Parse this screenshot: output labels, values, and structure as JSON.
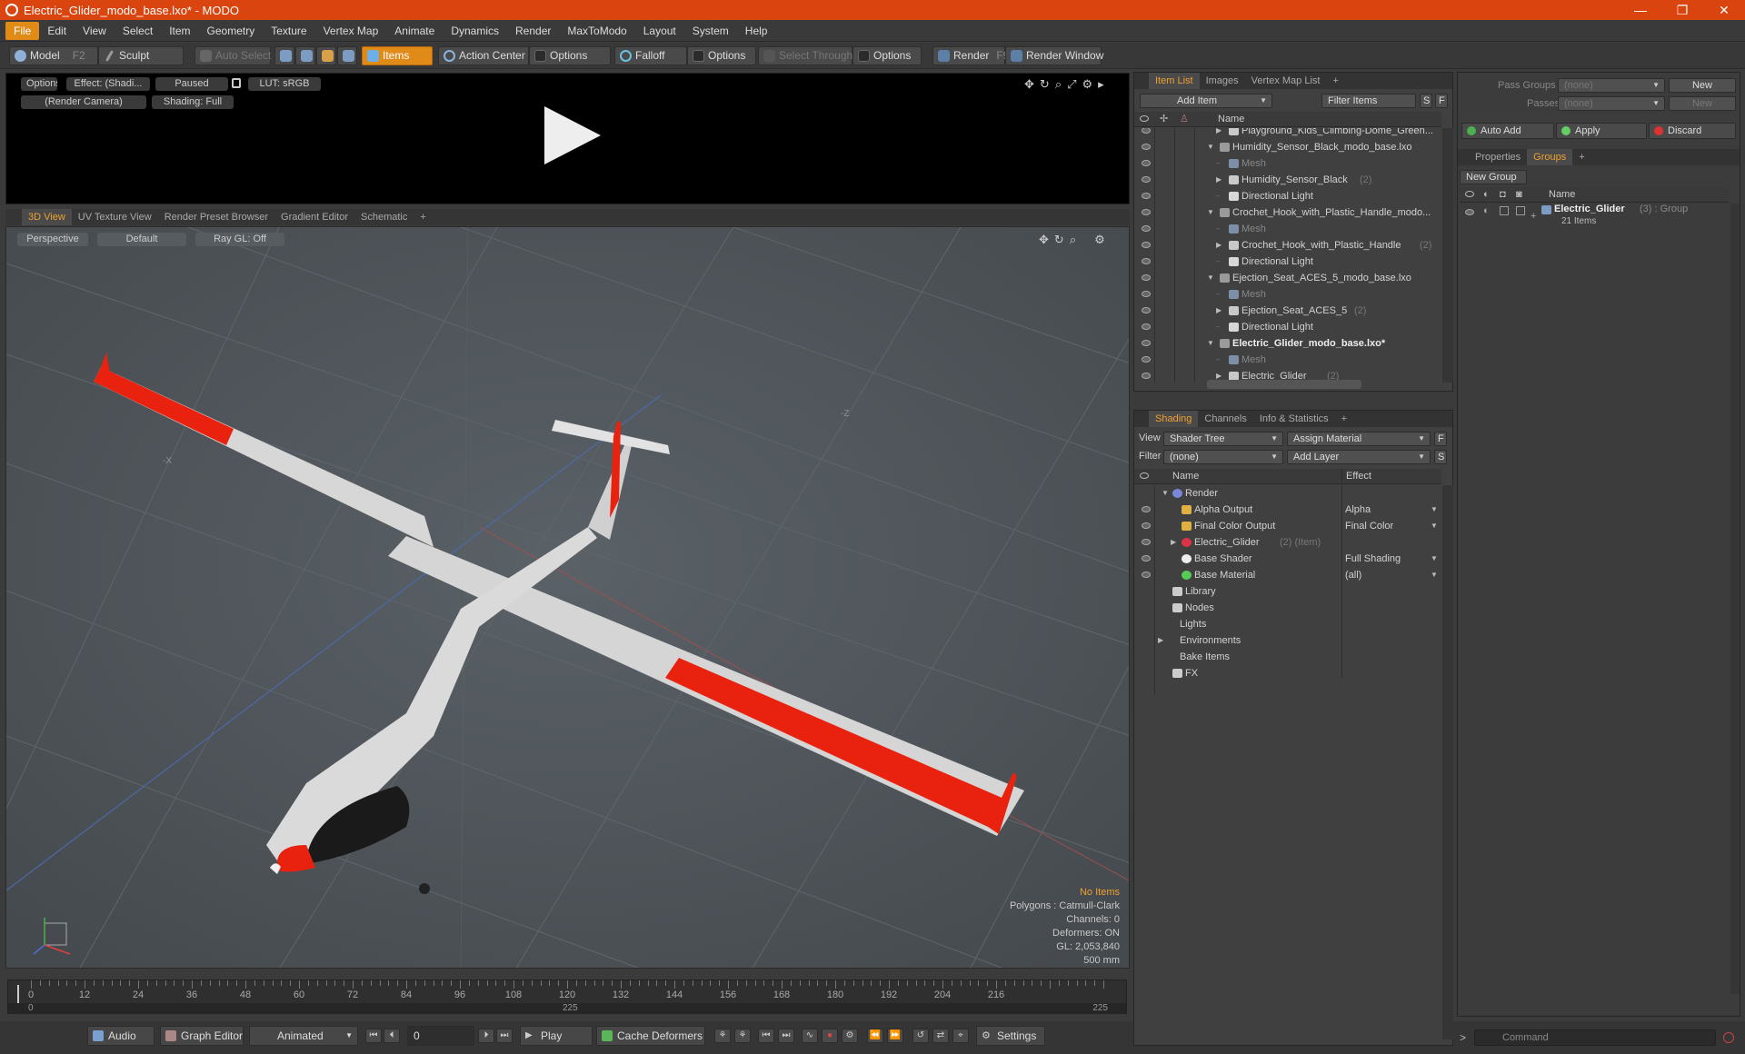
{
  "window": {
    "title": "Electric_Glider_modo_base.lxo* - MODO",
    "controls": [
      "—",
      "❐",
      "✕"
    ]
  },
  "menu": [
    "File",
    "Edit",
    "View",
    "Select",
    "Item",
    "Geometry",
    "Texture",
    "Vertex Map",
    "Animate",
    "Dynamics",
    "Render",
    "MaxToModo",
    "Layout",
    "System",
    "Help"
  ],
  "toolbar": {
    "model": "Model",
    "model_key": "F2",
    "sculpt": "Sculpt",
    "auto_select": "Auto Select",
    "items": "Items",
    "action_center": "Action Center",
    "options1": "Options",
    "falloff": "Falloff",
    "options2": "Options",
    "select_through": "Select Through",
    "options3": "Options",
    "render": "Render",
    "render_key": "F9",
    "render_window": "Render Window"
  },
  "render_panel": {
    "options": "Options",
    "effect": "Effect: (Shadi...",
    "paused": "Paused",
    "lut": "LUT: sRGB",
    "camera": "(Render Camera)",
    "shading": "Shading: Full"
  },
  "viewport_tabs": [
    "3D View",
    "UV Texture View",
    "Render Preset Browser",
    "Gradient Editor",
    "Schematic",
    "+"
  ],
  "viewport": {
    "perspective": "Perspective",
    "default": "Default",
    "raygl": "Ray GL: Off",
    "axis_x": "-X",
    "axis_z": "-Z",
    "stats": [
      "No Items",
      "Polygons : Catmull-Clark",
      "Channels: 0",
      "Deformers: ON",
      "GL: 2,053,840",
      "500 mm"
    ]
  },
  "timeline": {
    "labels": [
      "0",
      "12",
      "24",
      "36",
      "48",
      "60",
      "72",
      "84",
      "96",
      "108",
      "120",
      "132",
      "144",
      "156",
      "168",
      "180",
      "192",
      "204",
      "216"
    ],
    "bottom_left": "0",
    "bottom_mid": "225",
    "bottom_right": "225"
  },
  "bottombar": {
    "audio": "Audio",
    "graph_editor": "Graph Editor",
    "animated": "Animated",
    "frame": "0",
    "play": "Play",
    "cache_deformers": "Cache Deformers",
    "settings": "Settings"
  },
  "item_list": {
    "tabs": [
      "Item List",
      "Images",
      "Vertex Map List",
      "+"
    ],
    "add_item": "Add Item",
    "filter_items": "Filter Items",
    "s_btn": "S",
    "f_btn": "F",
    "col_name": "Name",
    "rows": [
      {
        "indent": 2,
        "exp": "▶",
        "icon": "folder",
        "label": "Playground_Kids_Climbing-Dome_Green...",
        "meta": "",
        "style": ""
      },
      {
        "indent": 1,
        "exp": "▼",
        "icon": "scene",
        "label": "Humidity_Sensor_Black_modo_base.lxo",
        "meta": "",
        "style": ""
      },
      {
        "indent": 2,
        "exp": "",
        "icon": "mesh",
        "label": "Mesh",
        "meta": "",
        "style": "dim"
      },
      {
        "indent": 2,
        "exp": "▶",
        "icon": "folder",
        "label": "Humidity_Sensor_Black",
        "meta": "(2)",
        "style": ""
      },
      {
        "indent": 2,
        "exp": "",
        "icon": "light",
        "label": "Directional Light",
        "meta": "",
        "style": ""
      },
      {
        "indent": 1,
        "exp": "▼",
        "icon": "scene",
        "label": "Crochet_Hook_with_Plastic_Handle_modo...",
        "meta": "",
        "style": ""
      },
      {
        "indent": 2,
        "exp": "",
        "icon": "mesh",
        "label": "Mesh",
        "meta": "",
        "style": "dim"
      },
      {
        "indent": 2,
        "exp": "▶",
        "icon": "folder",
        "label": "Crochet_Hook_with_Plastic_Handle",
        "meta": "(2)",
        "style": ""
      },
      {
        "indent": 2,
        "exp": "",
        "icon": "light",
        "label": "Directional Light",
        "meta": "",
        "style": ""
      },
      {
        "indent": 1,
        "exp": "▼",
        "icon": "scene",
        "label": "Ejection_Seat_ACES_5_modo_base.lxo",
        "meta": "",
        "style": ""
      },
      {
        "indent": 2,
        "exp": "",
        "icon": "mesh",
        "label": "Mesh",
        "meta": "",
        "style": "dim"
      },
      {
        "indent": 2,
        "exp": "▶",
        "icon": "folder",
        "label": "Ejection_Seat_ACES_5",
        "meta": "(2)",
        "style": ""
      },
      {
        "indent": 2,
        "exp": "",
        "icon": "light",
        "label": "Directional Light",
        "meta": "",
        "style": ""
      },
      {
        "indent": 1,
        "exp": "▼",
        "icon": "scene",
        "label": "Electric_Glider_modo_base.lxo*",
        "meta": "",
        "style": "bold"
      },
      {
        "indent": 2,
        "exp": "",
        "icon": "mesh",
        "label": "Mesh",
        "meta": "",
        "style": "dim"
      },
      {
        "indent": 2,
        "exp": "▶",
        "icon": "folder",
        "label": "Electric_Glider",
        "meta": "(2)",
        "style": ""
      }
    ]
  },
  "shading": {
    "tabs": [
      "Shading",
      "Channels",
      "Info & Statistics",
      "+"
    ],
    "view_label": "View",
    "view_value": "Shader Tree",
    "assign_material": "Assign Material",
    "f_btn": "F",
    "filter_label": "Filter",
    "filter_value": "(none)",
    "add_layer": "Add Layer",
    "s_btn": "S",
    "col_name": "Name",
    "col_effect": "Effect",
    "rows": [
      {
        "indent": 0,
        "exp": "▼",
        "icon": "render",
        "label": "Render",
        "meta": "",
        "effect": "",
        "eye": false
      },
      {
        "indent": 1,
        "exp": "",
        "icon": "output",
        "label": "Alpha Output",
        "meta": "",
        "effect": "Alpha",
        "eye": true
      },
      {
        "indent": 1,
        "exp": "",
        "icon": "output",
        "label": "Final Color Output",
        "meta": "",
        "effect": "Final Color",
        "eye": true
      },
      {
        "indent": 1,
        "exp": "▶",
        "icon": "mask",
        "label": "Electric_Glider",
        "meta": "(2) (Item)",
        "effect": "",
        "eye": true
      },
      {
        "indent": 1,
        "exp": "",
        "icon": "shader",
        "label": "Base Shader",
        "meta": "",
        "effect": "Full Shading",
        "eye": true
      },
      {
        "indent": 1,
        "exp": "",
        "icon": "material",
        "label": "Base Material",
        "meta": "",
        "effect": "(all)",
        "eye": true
      },
      {
        "indent": 0,
        "exp": "",
        "icon": "folder",
        "label": "Library",
        "meta": "",
        "effect": "",
        "eye": false
      },
      {
        "indent": 0,
        "exp": "",
        "icon": "folder",
        "label": "Nodes",
        "meta": "",
        "effect": "",
        "eye": false
      },
      {
        "indent": -1,
        "exp": "",
        "icon": "",
        "label": "Lights",
        "meta": "",
        "effect": "",
        "eye": false
      },
      {
        "indent": -1,
        "exp": "▶",
        "icon": "",
        "label": "Environments",
        "meta": "",
        "effect": "",
        "eye": false
      },
      {
        "indent": -1,
        "exp": "",
        "icon": "",
        "label": "Bake Items",
        "meta": "",
        "effect": "",
        "eye": false
      },
      {
        "indent": 0,
        "exp": "",
        "icon": "fx",
        "label": "FX",
        "meta": "",
        "effect": "",
        "eye": false
      }
    ]
  },
  "groups": {
    "pass_groups_label": "Pass Groups",
    "pass_groups_value": "(none)",
    "new1": "New",
    "passes_label": "Passes",
    "passes_value": "(none)",
    "new2": "New",
    "auto_add": "Auto Add",
    "apply": "Apply",
    "discard": "Discard",
    "tabs": [
      "Properties",
      "Groups",
      "+"
    ],
    "new_group": "New Group",
    "col_name": "Name",
    "group_name": "Electric_Glider",
    "group_meta": "(3) : Group",
    "group_items": "21 Items"
  },
  "command": {
    "placeholder": "Command",
    "prompt": ">"
  },
  "colors": {
    "accent": "#e08a18",
    "titlebar": "#d9440f",
    "glider_red": "#e8220e",
    "glider_white": "#dcdcdc"
  }
}
